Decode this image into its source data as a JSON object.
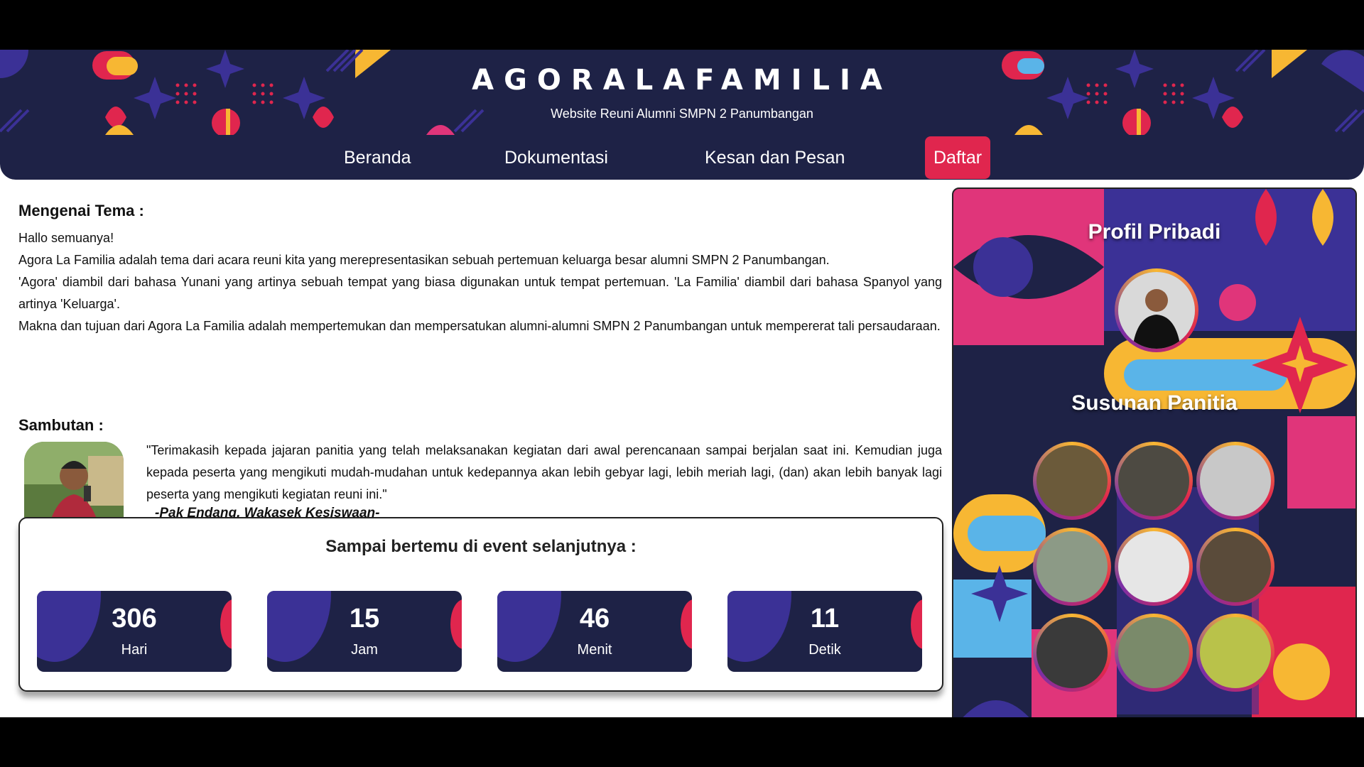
{
  "header": {
    "brand": "AGORALAFAMILIA",
    "tagline": "Website Reuni Alumni SMPN 2 Panumbangan"
  },
  "nav": {
    "items": [
      {
        "label": "Beranda"
      },
      {
        "label": "Dokumentasi"
      },
      {
        "label": "Kesan dan Pesan"
      },
      {
        "label": "Daftar"
      }
    ]
  },
  "tema": {
    "heading": "Mengenai Tema :",
    "lines": [
      "Hallo semuanya!",
      "Agora La Familia adalah tema dari acara reuni kita yang merepresentasikan sebuah pertemuan keluarga besar alumni SMPN 2 Panumbangan.",
      "'Agora' diambil dari bahasa Yunani yang artinya sebuah tempat yang biasa digunakan untuk tempat pertemuan. 'La Familia' diambil dari bahasa Spanyol yang artinya 'Keluarga'.",
      "Makna dan tujuan dari Agora La Familia adalah mempertemukan dan mempersatukan alumni-alumni SMPN 2 Panumbangan untuk mempererat tali persaudaraan."
    ]
  },
  "sambutan": {
    "heading": "Sambutan :",
    "quote": "\"Terimakasih kepada jajaran panitia yang telah melaksanakan kegiatan dari awal perencanaan sampai berjalan saat ini. Kemudian juga kepada peserta yang mengikuti mudah-mudahan untuk kedepannya akan lebih gebyar lagi, lebih meriah lagi, (dan) akan lebih banyak lagi peserta yang mengikuti kegiatan reuni ini.\"",
    "by": "-Pak Endang, Wakasek Kesiswaan-"
  },
  "countdown": {
    "title": "Sampai bertemu di event selanjutnya :",
    "items": [
      {
        "value": "306",
        "label": "Hari"
      },
      {
        "value": "15",
        "label": "Jam"
      },
      {
        "value": "46",
        "label": "Menit"
      },
      {
        "value": "11",
        "label": "Detik"
      }
    ]
  },
  "panel": {
    "profil_title": "Profil Pribadi",
    "panitia_title": "Susunan Panitia"
  },
  "colors": {
    "navy": "#1e2246",
    "accent_red": "#e0264e",
    "purple": "#3b3196",
    "yellow": "#f7b733",
    "sky": "#5ab4e8",
    "pink": "#e0357a"
  }
}
